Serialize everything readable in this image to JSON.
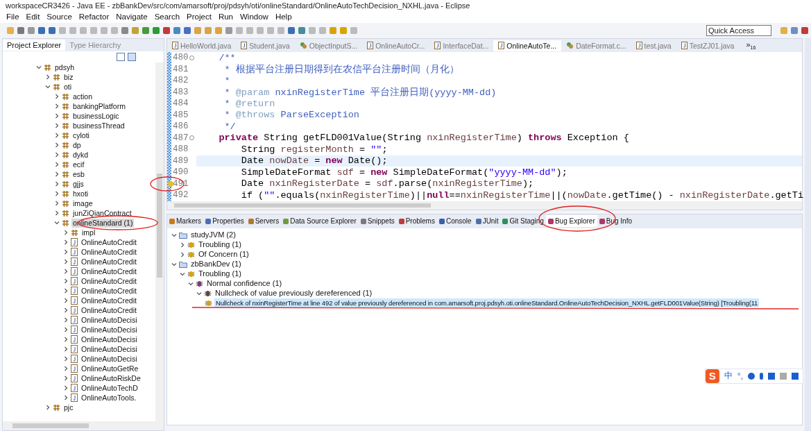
{
  "window": {
    "title": "workspaceCR3426 - Java EE - zbBankDev/src/com/amarsoft/proj/pdsyh/oti/onlineStandard/OnlineAutoTechDecision_NXHL.java - Eclipse"
  },
  "menu": [
    "File",
    "Edit",
    "Source",
    "Refactor",
    "Navigate",
    "Search",
    "Project",
    "Run",
    "Window",
    "Help"
  ],
  "quick_access": {
    "placeholder": "Quick Access"
  },
  "explorer": {
    "tabs": [
      {
        "label": "Project Explorer",
        "selected": true
      },
      {
        "label": "Type Hierarchy",
        "selected": false
      }
    ],
    "tree": [
      {
        "label": "pdsyh",
        "kind": "package",
        "expanded": true,
        "selected": false,
        "children": [
          {
            "label": "biz",
            "kind": "package",
            "expanded": false,
            "selected": false
          },
          {
            "label": "oti",
            "kind": "package",
            "expanded": true,
            "selected": false,
            "children": [
              {
                "label": "action",
                "kind": "package",
                "expanded": false,
                "selected": false
              },
              {
                "label": "bankingPlatform",
                "kind": "package",
                "expanded": false,
                "selected": false
              },
              {
                "label": "businessLogic",
                "kind": "package",
                "expanded": false,
                "selected": false
              },
              {
                "label": "businessThread",
                "kind": "package",
                "expanded": false,
                "selected": false
              },
              {
                "label": "cyloti",
                "kind": "package",
                "expanded": false,
                "selected": false
              },
              {
                "label": "dp",
                "kind": "package",
                "expanded": false,
                "selected": false
              },
              {
                "label": "dykd",
                "kind": "package",
                "expanded": false,
                "selected": false
              },
              {
                "label": "ecif",
                "kind": "package",
                "expanded": false,
                "selected": false
              },
              {
                "label": "esb",
                "kind": "package",
                "expanded": false,
                "selected": false
              },
              {
                "label": "gjjs",
                "kind": "package",
                "expanded": false,
                "selected": false
              },
              {
                "label": "hxoti",
                "kind": "package",
                "expanded": false,
                "selected": false
              },
              {
                "label": "image",
                "kind": "package",
                "expanded": false,
                "selected": false
              },
              {
                "label": "junZiQianContract",
                "kind": "package",
                "expanded": false,
                "selected": false
              },
              {
                "label": "onlineStandard (1)",
                "kind": "package",
                "expanded": true,
                "selected": true,
                "children": [
                  {
                    "label": "impl",
                    "kind": "package",
                    "expanded": false,
                    "selected": false
                  },
                  {
                    "label": "OnlineAutoCredit",
                    "kind": "java",
                    "expanded": false,
                    "selected": false
                  },
                  {
                    "label": "OnlineAutoCredit",
                    "kind": "java",
                    "expanded": false,
                    "selected": false
                  },
                  {
                    "label": "OnlineAutoCredit",
                    "kind": "java",
                    "expanded": false,
                    "selected": false
                  },
                  {
                    "label": "OnlineAutoCredit",
                    "kind": "java",
                    "expanded": false,
                    "selected": false
                  },
                  {
                    "label": "OnlineAutoCredit",
                    "kind": "java",
                    "expanded": false,
                    "selected": false
                  },
                  {
                    "label": "OnlineAutoCredit",
                    "kind": "java",
                    "expanded": false,
                    "selected": false
                  },
                  {
                    "label": "OnlineAutoCredit",
                    "kind": "java",
                    "expanded": false,
                    "selected": false
                  },
                  {
                    "label": "OnlineAutoCredit",
                    "kind": "java",
                    "expanded": false,
                    "selected": false
                  },
                  {
                    "label": "OnlineAutoDecisi",
                    "kind": "java",
                    "expanded": false,
                    "selected": false
                  },
                  {
                    "label": "OnlineAutoDecisi",
                    "kind": "java",
                    "expanded": false,
                    "selected": false
                  },
                  {
                    "label": "OnlineAutoDecisi",
                    "kind": "java",
                    "expanded": false,
                    "selected": false
                  },
                  {
                    "label": "OnlineAutoDecisi",
                    "kind": "java",
                    "expanded": false,
                    "selected": false
                  },
                  {
                    "label": "OnlineAutoDecisi",
                    "kind": "java",
                    "expanded": false,
                    "selected": false
                  },
                  {
                    "label": "OnlineAutoGetRe",
                    "kind": "java",
                    "expanded": false,
                    "selected": false
                  },
                  {
                    "label": "OnlineAutoRiskDe",
                    "kind": "java",
                    "expanded": false,
                    "selected": false
                  },
                  {
                    "label": "OnlineAutoTechD",
                    "kind": "java",
                    "expanded": false,
                    "selected": false
                  },
                  {
                    "label": "OnlineAutoTools.",
                    "kind": "java",
                    "expanded": false,
                    "selected": false
                  }
                ]
              }
            ]
          },
          {
            "label": "pjc",
            "kind": "package",
            "expanded": false,
            "selected": false
          }
        ]
      }
    ]
  },
  "editor": {
    "tabs": [
      {
        "label": "HelloWorld.java",
        "kind": "java",
        "selected": false
      },
      {
        "label": "Student.java",
        "kind": "java",
        "selected": false
      },
      {
        "label": "ObjectInputS...",
        "kind": "class",
        "selected": false
      },
      {
        "label": "OnlineAutoCr...",
        "kind": "java",
        "selected": false
      },
      {
        "label": "InterfaceDat...",
        "kind": "java",
        "selected": false
      },
      {
        "label": "OnlineAutoTe...",
        "kind": "java",
        "selected": true
      },
      {
        "label": "DateFormat.c...",
        "kind": "class",
        "selected": false
      },
      {
        "label": "test.java",
        "kind": "java",
        "selected": false
      },
      {
        "label": "TestZJ01.java",
        "kind": "java",
        "selected": false
      }
    ],
    "overflow": "»",
    "overflow_count": "16",
    "lines": [
      {
        "number": "480",
        "foldable": true,
        "current": false,
        "warning": false,
        "segments": [
          {
            "kind": "comment",
            "text": "    /**"
          }
        ]
      },
      {
        "number": "481",
        "foldable": false,
        "current": false,
        "warning": false,
        "segments": [
          {
            "kind": "comment",
            "text": "     * 根据平台注册日期得到在农信平台注册时间（月化）"
          }
        ]
      },
      {
        "number": "482",
        "foldable": false,
        "current": false,
        "warning": false,
        "segments": [
          {
            "kind": "comment",
            "text": "     *"
          }
        ]
      },
      {
        "number": "483",
        "foldable": false,
        "current": false,
        "warning": false,
        "segments": [
          {
            "kind": "comment",
            "text": "     * "
          },
          {
            "kind": "tag",
            "text": "@param"
          },
          {
            "kind": "comment",
            "text": " nxinRegisterTime 平台注册日期(yyyy-MM-dd)"
          }
        ]
      },
      {
        "number": "484",
        "foldable": false,
        "current": false,
        "warning": false,
        "segments": [
          {
            "kind": "comment",
            "text": "     * "
          },
          {
            "kind": "tag",
            "text": "@return"
          }
        ]
      },
      {
        "number": "485",
        "foldable": false,
        "current": false,
        "warning": false,
        "segments": [
          {
            "kind": "comment",
            "text": "     * "
          },
          {
            "kind": "tag",
            "text": "@throws"
          },
          {
            "kind": "comment",
            "text": " ParseException"
          }
        ]
      },
      {
        "number": "486",
        "foldable": false,
        "current": false,
        "warning": false,
        "segments": [
          {
            "kind": "comment",
            "text": "     */"
          }
        ]
      },
      {
        "number": "487",
        "foldable": true,
        "current": false,
        "warning": false,
        "segments": [
          {
            "kind": "keyword",
            "text": "    private"
          },
          {
            "kind": "plain",
            "text": " String getFLD001Value(String "
          },
          {
            "kind": "variable",
            "text": "nxinRegisterTime"
          },
          {
            "kind": "plain",
            "text": ") "
          },
          {
            "kind": "keyword",
            "text": "throws"
          },
          {
            "kind": "plain",
            "text": " Exception {"
          }
        ]
      },
      {
        "number": "488",
        "foldable": false,
        "current": false,
        "warning": false,
        "segments": [
          {
            "kind": "plain",
            "text": "        String "
          },
          {
            "kind": "variable",
            "text": "registerMonth"
          },
          {
            "kind": "plain",
            "text": " = "
          },
          {
            "kind": "string",
            "text": "\"\""
          },
          {
            "kind": "plain",
            "text": ";"
          }
        ]
      },
      {
        "number": "489",
        "foldable": false,
        "current": true,
        "warning": false,
        "segments": [
          {
            "kind": "plain",
            "text": "        Date "
          },
          {
            "kind": "variable",
            "text": "nowDate"
          },
          {
            "kind": "plain",
            "text": " = "
          },
          {
            "kind": "keyword",
            "text": "new"
          },
          {
            "kind": "plain",
            "text": " Date();"
          }
        ]
      },
      {
        "number": "490",
        "foldable": false,
        "current": false,
        "warning": false,
        "segments": [
          {
            "kind": "plain",
            "text": "        SimpleDateFormat "
          },
          {
            "kind": "variable",
            "text": "sdf"
          },
          {
            "kind": "plain",
            "text": " = "
          },
          {
            "kind": "keyword",
            "text": "new"
          },
          {
            "kind": "plain",
            "text": " SimpleDateFormat("
          },
          {
            "kind": "string",
            "text": "\"yyyy-MM-dd\""
          },
          {
            "kind": "plain",
            "text": ");"
          }
        ]
      },
      {
        "number": "491",
        "foldable": false,
        "current": false,
        "warning": true,
        "segments": [
          {
            "kind": "plain",
            "text": "        Date "
          },
          {
            "kind": "variable",
            "text": "nxinRegisterDate"
          },
          {
            "kind": "plain",
            "text": " = "
          },
          {
            "kind": "variable",
            "text": "sdf"
          },
          {
            "kind": "plain",
            "text": ".parse("
          },
          {
            "kind": "variable",
            "text": "nxinRegisterTime"
          },
          {
            "kind": "plain",
            "text": ");"
          }
        ]
      },
      {
        "number": "492",
        "foldable": false,
        "current": false,
        "warning": false,
        "segments": [
          {
            "kind": "plain",
            "text": "        if ("
          },
          {
            "kind": "string",
            "text": "\"\""
          },
          {
            "kind": "plain",
            "text": ".equals("
          },
          {
            "kind": "variable",
            "text": "nxinRegisterTime"
          },
          {
            "kind": "plain",
            "text": ")||"
          },
          {
            "kind": "keyword",
            "text": "null"
          },
          {
            "kind": "plain",
            "text": "=="
          },
          {
            "kind": "variable",
            "text": "nxinRegisterTime"
          },
          {
            "kind": "plain",
            "text": "||("
          },
          {
            "kind": "variable",
            "text": "nowDate"
          },
          {
            "kind": "plain",
            "text": ".getTime() - "
          },
          {
            "kind": "variable",
            "text": "nxinRegisterDate"
          },
          {
            "kind": "plain",
            "text": ".getTi"
          }
        ]
      }
    ]
  },
  "bottom": {
    "tabs": [
      {
        "label": "Markers",
        "kind": "markers",
        "selected": false
      },
      {
        "label": "Properties",
        "kind": "properties",
        "selected": false
      },
      {
        "label": "Servers",
        "kind": "servers",
        "selected": false
      },
      {
        "label": "Data Source Explorer",
        "kind": "datasource",
        "selected": false
      },
      {
        "label": "Snippets",
        "kind": "snippets",
        "selected": false
      },
      {
        "label": "Problems",
        "kind": "problems",
        "selected": false
      },
      {
        "label": "Console",
        "kind": "console",
        "selected": false
      },
      {
        "label": "JUnit",
        "kind": "junit",
        "selected": false
      },
      {
        "label": "Git Staging",
        "kind": "git",
        "selected": false
      },
      {
        "label": "Bug Explorer",
        "kind": "bug",
        "selected": true
      },
      {
        "label": "Bug Info",
        "kind": "bug",
        "selected": false
      }
    ],
    "tree": [
      {
        "label": "studyJVM (2)",
        "kind": "project",
        "expanded": true,
        "selected": false,
        "children": [
          {
            "label": "Troubling (1)",
            "kind": "category",
            "expanded": false,
            "selected": false
          },
          {
            "label": "Of Concern (1)",
            "kind": "category",
            "expanded": false,
            "selected": false
          }
        ]
      },
      {
        "label": "zbBankDev (1)",
        "kind": "project",
        "expanded": true,
        "selected": false,
        "children": [
          {
            "label": "Troubling (1)",
            "kind": "category",
            "expanded": true,
            "selected": false,
            "children": [
              {
                "label": "Normal confidence (1)",
                "kind": "confidence",
                "expanded": true,
                "selected": false,
                "children": [
                  {
                    "label": "Nullcheck of value previously dereferenced (1)",
                    "kind": "pattern",
                    "expanded": true,
                    "selected": false,
                    "children": [
                      {
                        "label": "Nullcheck of nxinRegisterTime at line 492 of value previously dereferenced in com.amarsoft.proj.pdsyh.oti.onlineStandard.OnlineAutoTechDecision_NXHL.getFLD001Value(String) [Troubling(11",
                        "kind": "bug",
                        "selected": true
                      }
                    ]
                  }
                ]
              }
            ]
          }
        ]
      }
    ]
  },
  "ime_bar": {
    "logo": "S",
    "mode": "中",
    "punctuation": "°,"
  }
}
